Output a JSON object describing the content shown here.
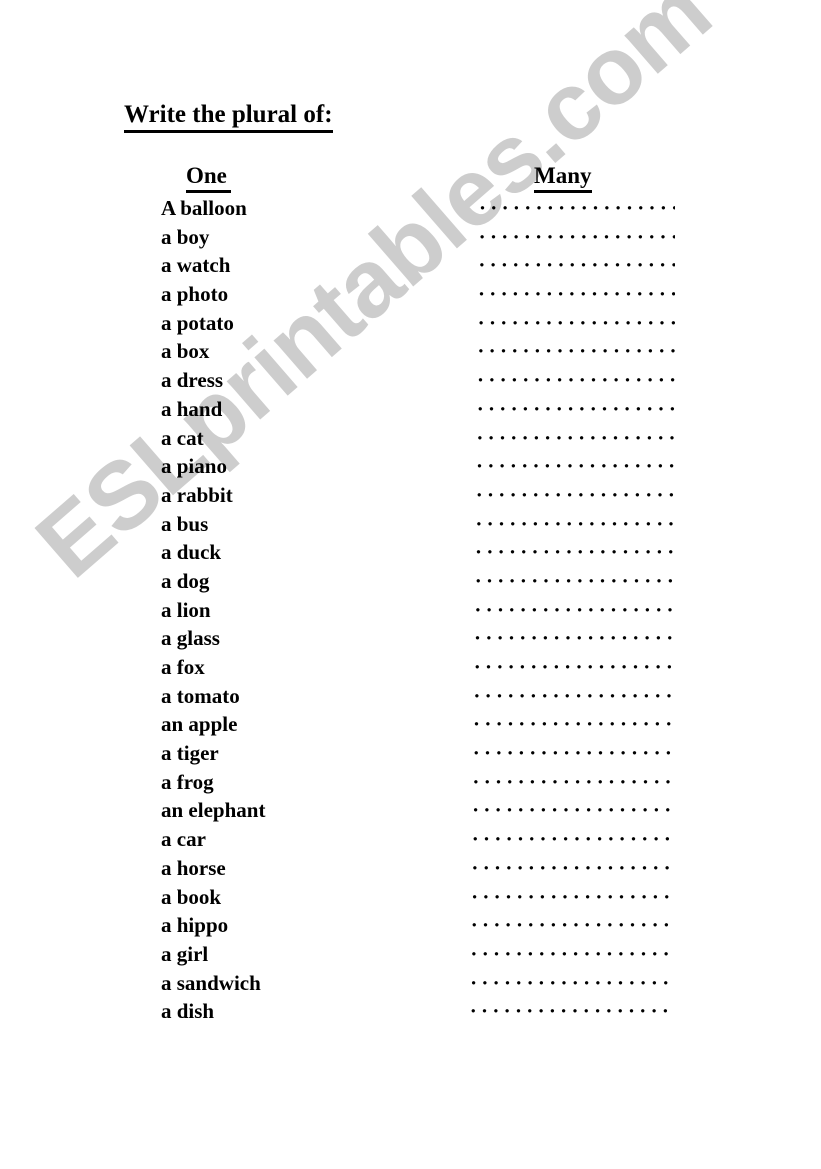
{
  "document": {
    "title": "Write the plural of:",
    "watermark": "ESLprintables.com",
    "watermark_color": "#cdcdcd",
    "text_color": "#000000",
    "background_color": "#ffffff"
  },
  "columns": {
    "left_header": "One",
    "right_header": "Many"
  },
  "answer_line": {
    "dot_character": "·",
    "dot_count": 24
  },
  "rows": [
    {
      "singular": "A balloon",
      "answer": ""
    },
    {
      "singular": "a boy",
      "answer": ""
    },
    {
      "singular": "a watch",
      "answer": ""
    },
    {
      "singular": "a photo",
      "answer": ""
    },
    {
      "singular": "a potato",
      "answer": ""
    },
    {
      "singular": "a box",
      "answer": ""
    },
    {
      "singular": "a dress",
      "answer": ""
    },
    {
      "singular": "a hand",
      "answer": ""
    },
    {
      "singular": "a cat",
      "answer": ""
    },
    {
      "singular": "a piano",
      "answer": ""
    },
    {
      "singular": "a rabbit",
      "answer": ""
    },
    {
      "singular": "a bus",
      "answer": ""
    },
    {
      "singular": "a duck",
      "answer": ""
    },
    {
      "singular": "a dog",
      "answer": ""
    },
    {
      "singular": "a lion",
      "answer": ""
    },
    {
      "singular": "a glass",
      "answer": ""
    },
    {
      "singular": "a fox",
      "answer": ""
    },
    {
      "singular": "a tomato",
      "answer": ""
    },
    {
      "singular": "an apple",
      "answer": ""
    },
    {
      "singular": "a tiger",
      "answer": ""
    },
    {
      "singular": "a frog",
      "answer": ""
    },
    {
      "singular": "an elephant",
      "answer": ""
    },
    {
      "singular": "a car",
      "answer": ""
    },
    {
      "singular": "a horse",
      "answer": ""
    },
    {
      "singular": "a book",
      "answer": ""
    },
    {
      "singular": "a hippo",
      "answer": ""
    },
    {
      "singular": "a girl",
      "answer": ""
    },
    {
      "singular": "a sandwich",
      "answer": ""
    },
    {
      "singular": "a dish",
      "answer": ""
    }
  ]
}
